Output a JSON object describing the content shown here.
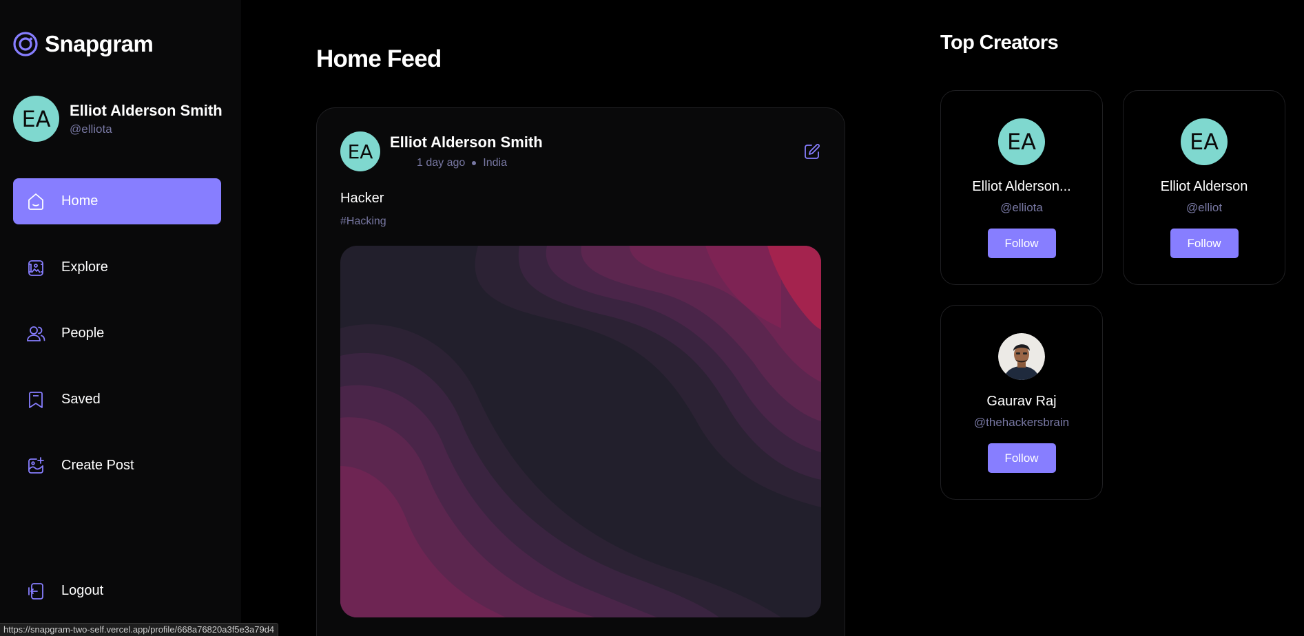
{
  "app": {
    "name": "Snapgram",
    "accent": "#877eff"
  },
  "user": {
    "initials": "EA",
    "name": "Elliot Alderson Smith",
    "handle": "@elliota"
  },
  "nav": {
    "items": [
      {
        "label": "Home",
        "icon": "home-icon",
        "active": true
      },
      {
        "label": "Explore",
        "icon": "explore-icon",
        "active": false
      },
      {
        "label": "People",
        "icon": "people-icon",
        "active": false
      },
      {
        "label": "Saved",
        "icon": "bookmark-icon",
        "active": false
      },
      {
        "label": "Create Post",
        "icon": "create-post-icon",
        "active": false
      }
    ],
    "logout_label": "Logout"
  },
  "feed": {
    "title": "Home Feed",
    "post": {
      "author_initials": "EA",
      "author": "Elliot Alderson Smith",
      "time": "1 day ago",
      "location": "India",
      "caption": "Hacker",
      "tags": "#Hacking"
    }
  },
  "creators": {
    "title": "Top Creators",
    "items": [
      {
        "initials": "EA",
        "name": "Elliot Alderson...",
        "handle": "@elliota",
        "follow_label": "Follow"
      },
      {
        "initials": "EA",
        "name": "Elliot Alderson",
        "handle": "@elliot",
        "follow_label": "Follow"
      },
      {
        "initials": "",
        "name": "Gaurav Raj",
        "handle": "@thehackersbrain",
        "follow_label": "Follow"
      }
    ]
  },
  "status_bar": {
    "url": "https://snapgram-two-self.vercel.app/profile/668a76820a3f5e3a79d4"
  }
}
